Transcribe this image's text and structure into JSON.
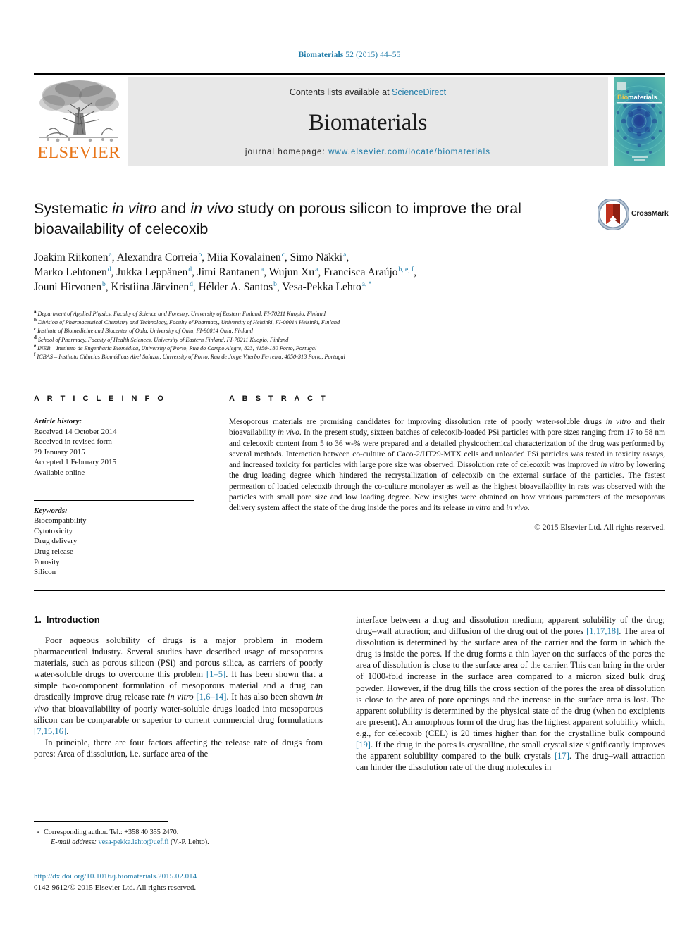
{
  "running_head": {
    "journal": "Biomaterials",
    "citation": " 52 (2015) 44–55"
  },
  "masthead": {
    "contents_prefix": "Contents lists available at ",
    "contents_link": "ScienceDirect",
    "journal_name": "Biomaterials",
    "homepage_prefix": "journal homepage: ",
    "homepage_url": "www.elsevier.com/locate/biomaterials",
    "publisher_wordmark": "ELSEVIER",
    "cover_title_a": "Bio",
    "cover_title_b": "materials"
  },
  "article": {
    "title_line1_a": "Systematic ",
    "title_line1_it1": "in vitro",
    "title_line1_b": " and ",
    "title_line1_it2": "in vivo",
    "title_line1_c": " study on porous silicon to improve the",
    "title_line2": "oral bioavailability of celecoxib",
    "crossmark_label": "CrossMark"
  },
  "authors": {
    "lines": [
      [
        {
          "name": "Joakim Riikonen",
          "sup": "a"
        },
        {
          "name": "Alexandra Correia",
          "sup": "b"
        },
        {
          "name": "Miia Kovalainen",
          "sup": "c"
        },
        {
          "name": "Simo Näkki",
          "sup": "a"
        }
      ],
      [
        {
          "name": "Marko Lehtonen",
          "sup": "d"
        },
        {
          "name": "Jukka Leppänen",
          "sup": "d"
        },
        {
          "name": "Jimi Rantanen",
          "sup": "a"
        },
        {
          "name": "Wujun Xu",
          "sup": "a"
        },
        {
          "name": "Francisca Araújo",
          "sup": "b, e, f"
        }
      ],
      [
        {
          "name": "Jouni Hirvonen",
          "sup": "b"
        },
        {
          "name": "Kristiina Järvinen",
          "sup": "d"
        },
        {
          "name": "Hélder A. Santos",
          "sup": "b"
        },
        {
          "name": "Vesa-Pekka Lehto",
          "sup": "a, *"
        }
      ]
    ]
  },
  "affiliations": [
    {
      "mark": "a",
      "text": "Department of Applied Physics, Faculty of Science and Forestry, University of Eastern Finland, FI-70211 Kuopio, Finland"
    },
    {
      "mark": "b",
      "text": "Division of Pharmaceutical Chemistry and Technology, Faculty of Pharmacy, University of Helsinki, FI-00014 Helsinki, Finland"
    },
    {
      "mark": "c",
      "text": "Institute of Biomedicine and Biocenter of Oulu, University of Oulu, FI-90014 Oulu, Finland"
    },
    {
      "mark": "d",
      "text": "School of Pharmacy, Faculty of Health Sciences, University of Eastern Finland, FI-70211 Kuopio, Finland"
    },
    {
      "mark": "e",
      "text": "INEB – Instituto de Engenharia Biomédica, University of Porto, Rua do Campo Alegre, 823, 4150-180 Porto, Portugal"
    },
    {
      "mark": "f",
      "text": "ICBAS – Instituto Ciências Biomédicas Abel Salazar, University of Porto, Rua de Jorge Viterbo Ferreira, 4050-313 Porto, Portugal"
    }
  ],
  "article_info": {
    "heading": "A R T I C L E   I N F O",
    "history_label": "Article history:",
    "history": [
      "Received 14 October 2014",
      "Received in revised form",
      "29 January 2015",
      "Accepted 1 February 2015",
      "Available online"
    ],
    "keywords_label": "Keywords:",
    "keywords": [
      "Biocompatibility",
      "Cytotoxicity",
      "Drug delivery",
      "Drug release",
      "Porosity",
      "Silicon"
    ]
  },
  "abstract": {
    "heading": "A B S T R A C T",
    "p1_a": "Mesoporous materials are promising candidates for improving dissolution rate of poorly water-soluble drugs ",
    "p1_it1": "in vitro",
    "p1_b": " and their bioavailability ",
    "p1_it2": "in vivo",
    "p1_c": ". In the present study, sixteen batches of celecoxib-loaded PSi particles with pore sizes ranging from 17 to 58 nm and celecoxib content from 5 to 36 w-% were prepared and a detailed physicochemical characterization of the drug was performed by several methods. Interaction between co-culture of Caco-2/HT29-MTX cells and unloaded PSi particles was tested in toxicity assays, and increased toxicity for particles with large pore size was observed. Dissolution rate of celecoxib was improved ",
    "p1_it3": "in vitro",
    "p1_d": " by lowering the drug loading degree which hindered the recrystallization of celecoxib on the external surface of the particles. The fastest permeation of loaded celecoxib through the co-culture monolayer as well as the highest bioavailability in rats was observed with the particles with small pore size and low loading degree. New insights were obtained on how various parameters of the mesoporous delivery system affect the state of the drug inside the pores and its release ",
    "p1_it4": "in vitro",
    "p1_e": " and ",
    "p1_it5": "in vivo",
    "p1_f": ".",
    "copyright": "© 2015 Elsevier Ltd. All rights reserved."
  },
  "body": {
    "section_number": "1.",
    "section_title": "Introduction",
    "left_p1_a": "Poor aqueous solubility of drugs is a major problem in modern pharmaceutical industry. Several studies have described usage of mesoporous materials, such as porous silicon (PSi) and porous silica, as carriers of poorly water-soluble drugs to overcome this problem ",
    "left_p1_r1": "[1–5]",
    "left_p1_b": ". It has been shown that a simple two-component formulation of mesoporous material and a drug can drastically improve drug release rate ",
    "left_p1_it1": "in vitro",
    "left_p1_c": " ",
    "left_p1_r2": "[1,6–14]",
    "left_p1_d": ". It has also been shown ",
    "left_p1_it2": "in vivo",
    "left_p1_e": " that bioavailability of poorly water-soluble drugs loaded into mesoporous silicon can be comparable or superior to current commercial drug formulations ",
    "left_p1_r3": "[7,15,16]",
    "left_p1_f": ".",
    "left_p2": "In principle, there are four factors affecting the release rate of drugs from pores: Area of dissolution, i.e. surface area of the",
    "right_p1_a": "interface between a drug and dissolution medium; apparent solubility of the drug; drug–wall attraction; and diffusion of the drug out of the pores ",
    "right_p1_r1": "[1,17,18]",
    "right_p1_b": ". The area of dissolution is determined by the surface area of the carrier and the form in which the drug is inside the pores. If the drug forms a thin layer on the surfaces of the pores the area of dissolution is close to the surface area of the carrier. This can bring in the order of 1000-fold increase in the surface area compared to a micron sized bulk drug powder. However, if the drug fills the cross section of the pores the area of dissolution is close to the area of pore openings and the increase in the surface area is lost. The apparent solubility is determined by the physical state of the drug (when no excipients are present). An amorphous form of the drug has the highest apparent solubility which, e.g., for celecoxib (CEL) is 20 times higher than for the crystalline bulk compound ",
    "right_p1_r2": "[19]",
    "right_p1_c": ". If the drug in the pores is crystalline, the small crystal size significantly improves the apparent solubility compared to the bulk crystals ",
    "right_p1_r3": "[17]",
    "right_p1_d": ". The drug–wall attraction can hinder the dissolution rate of the drug molecules in"
  },
  "footer": {
    "corresponding_label": "Corresponding author. Tel.: +358 40 355 2470.",
    "email_label": "E-mail address:",
    "email": "vesa-pekka.lehto@uef.fi",
    "email_owner": " (V.-P. Lehto).",
    "doi_url": "http://dx.doi.org/10.1016/j.biomaterials.2015.02.014",
    "issn_line": "0142-9612/© 2015 Elsevier Ltd. All rights reserved."
  },
  "colors": {
    "link": "#1f7ba8",
    "elsevier_orange": "#e8761a",
    "cover_teal": "#3a9fa8",
    "crossmark_red": "#c0321f"
  }
}
